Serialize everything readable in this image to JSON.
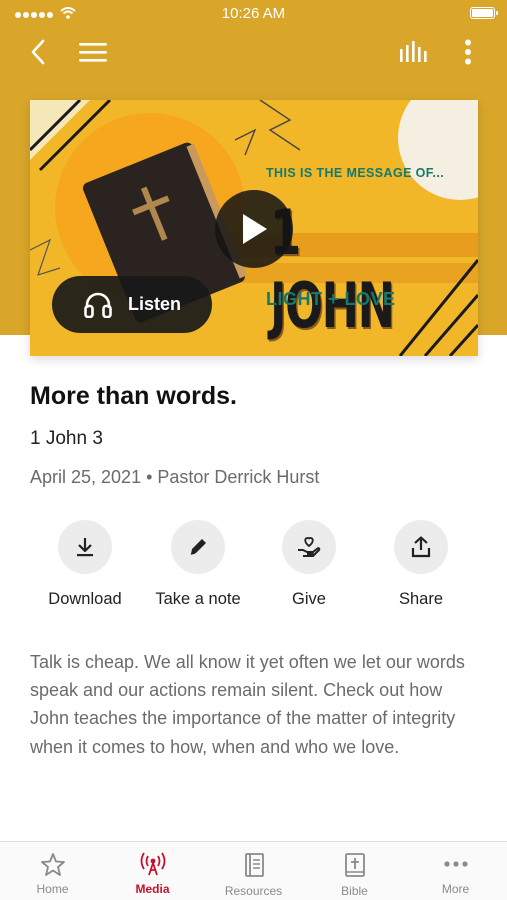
{
  "colors": {
    "header_gold": "#d9a62a",
    "accent_red": "#c8102e",
    "hero_teal": "#137a6e"
  },
  "status_bar": {
    "time": "10:26 AM",
    "signal_icon": "signal-dots-icon",
    "wifi_icon": "wifi-icon",
    "battery_icon": "battery-icon"
  },
  "nav": {
    "back_icon": "chevron-left-icon",
    "menu_icon": "hamburger-menu-icon",
    "audio_icon": "audio-levels-icon",
    "more_icon": "vertical-dots-icon"
  },
  "hero": {
    "kicker": "THIS IS THE MESSAGE OF...",
    "title": "1 JOHN",
    "subtitle": "LIGHT + LOVE",
    "play_icon": "play-icon",
    "listen_label": "Listen",
    "listen_icon": "headphones-icon"
  },
  "sermon": {
    "title": "More than words.",
    "scripture": "1 John 3",
    "meta": "April 25, 2021 • Pastor Derrick Hurst",
    "description": "Talk is cheap. We all know it yet often we let our words speak and our actions remain silent. Check out how John teaches the importance of the matter of integrity when it comes to how, when and who we love."
  },
  "actions": [
    {
      "label": "Download",
      "icon": "download-icon"
    },
    {
      "label": "Take a note",
      "icon": "pencil-icon"
    },
    {
      "label": "Give",
      "icon": "give-hand-heart-icon"
    },
    {
      "label": "Share",
      "icon": "share-icon"
    }
  ],
  "tabs": [
    {
      "label": "Home",
      "icon": "star-icon",
      "active": false
    },
    {
      "label": "Media",
      "icon": "broadcast-icon",
      "active": true
    },
    {
      "label": "Resources",
      "icon": "notebook-icon",
      "active": false
    },
    {
      "label": "Bible",
      "icon": "bible-icon",
      "active": false
    },
    {
      "label": "More",
      "icon": "more-dots-icon",
      "active": false
    }
  ]
}
